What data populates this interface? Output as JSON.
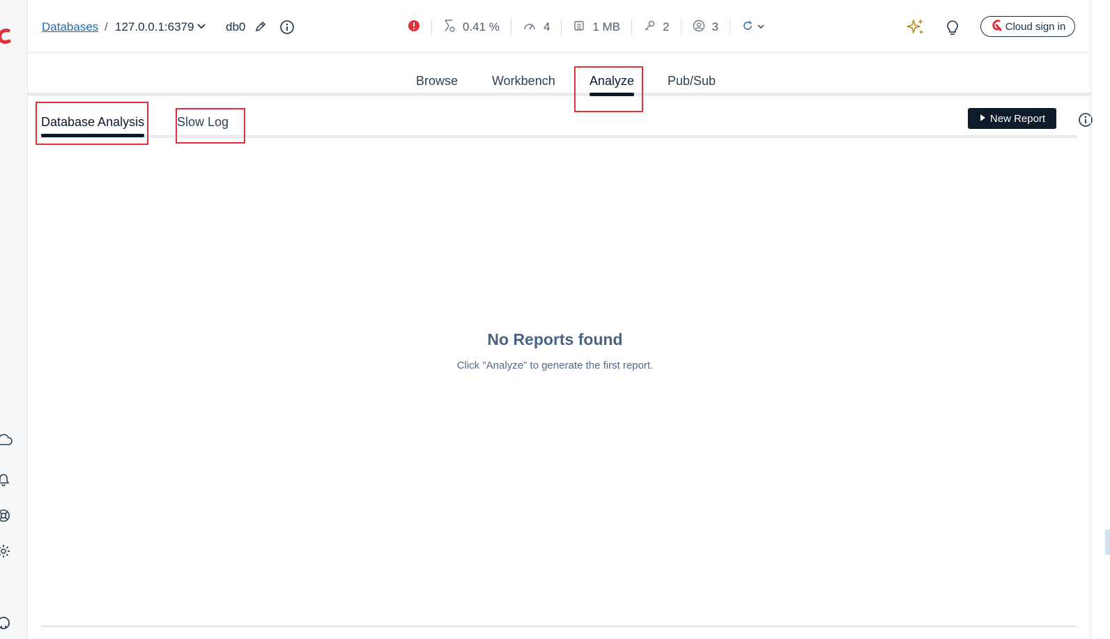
{
  "header": {
    "breadcrumb_root": "Databases",
    "breadcrumb_sep": "/",
    "db_address": "127.0.0.1:6379",
    "db_index": "db0",
    "stats": {
      "cpu": "0.41 %",
      "ops": "4",
      "memory": "1 MB",
      "keys": "2",
      "clients": "3"
    },
    "cloud_button": "Cloud sign in"
  },
  "main_tabs": [
    {
      "label": "Browse"
    },
    {
      "label": "Workbench"
    },
    {
      "label": "Analyze"
    },
    {
      "label": "Pub/Sub"
    }
  ],
  "main_tabs_active": "Analyze",
  "sub_tabs": [
    {
      "label": "Database Analysis"
    },
    {
      "label": "Slow Log"
    }
  ],
  "sub_tabs_active": "Database Analysis",
  "toolbar": {
    "new_report": "New Report"
  },
  "empty_state": {
    "title": "No Reports found",
    "subtitle": "Click \"Analyze\" to generate the first report."
  },
  "colors": {
    "accent_dark": "#0d1b2a",
    "link": "#1a6cb0",
    "brand_red": "#e0313b",
    "highlight": "#e0313b",
    "copilot_gold": "#b8861b"
  },
  "icons": {
    "sidebar": [
      "redis-logo-icon",
      "cloud-icon",
      "bell-icon",
      "lifebuoy-icon",
      "gear-icon",
      "github-icon"
    ],
    "header": [
      "chevron-down-icon",
      "pencil-icon",
      "info-icon",
      "alert-icon",
      "cpu-icon",
      "ops-gauge-icon",
      "memory-icon",
      "key-icon",
      "clients-icon",
      "refresh-icon",
      "sparkle-icon",
      "lightbulb-icon",
      "redis-cloud-icon"
    ]
  }
}
